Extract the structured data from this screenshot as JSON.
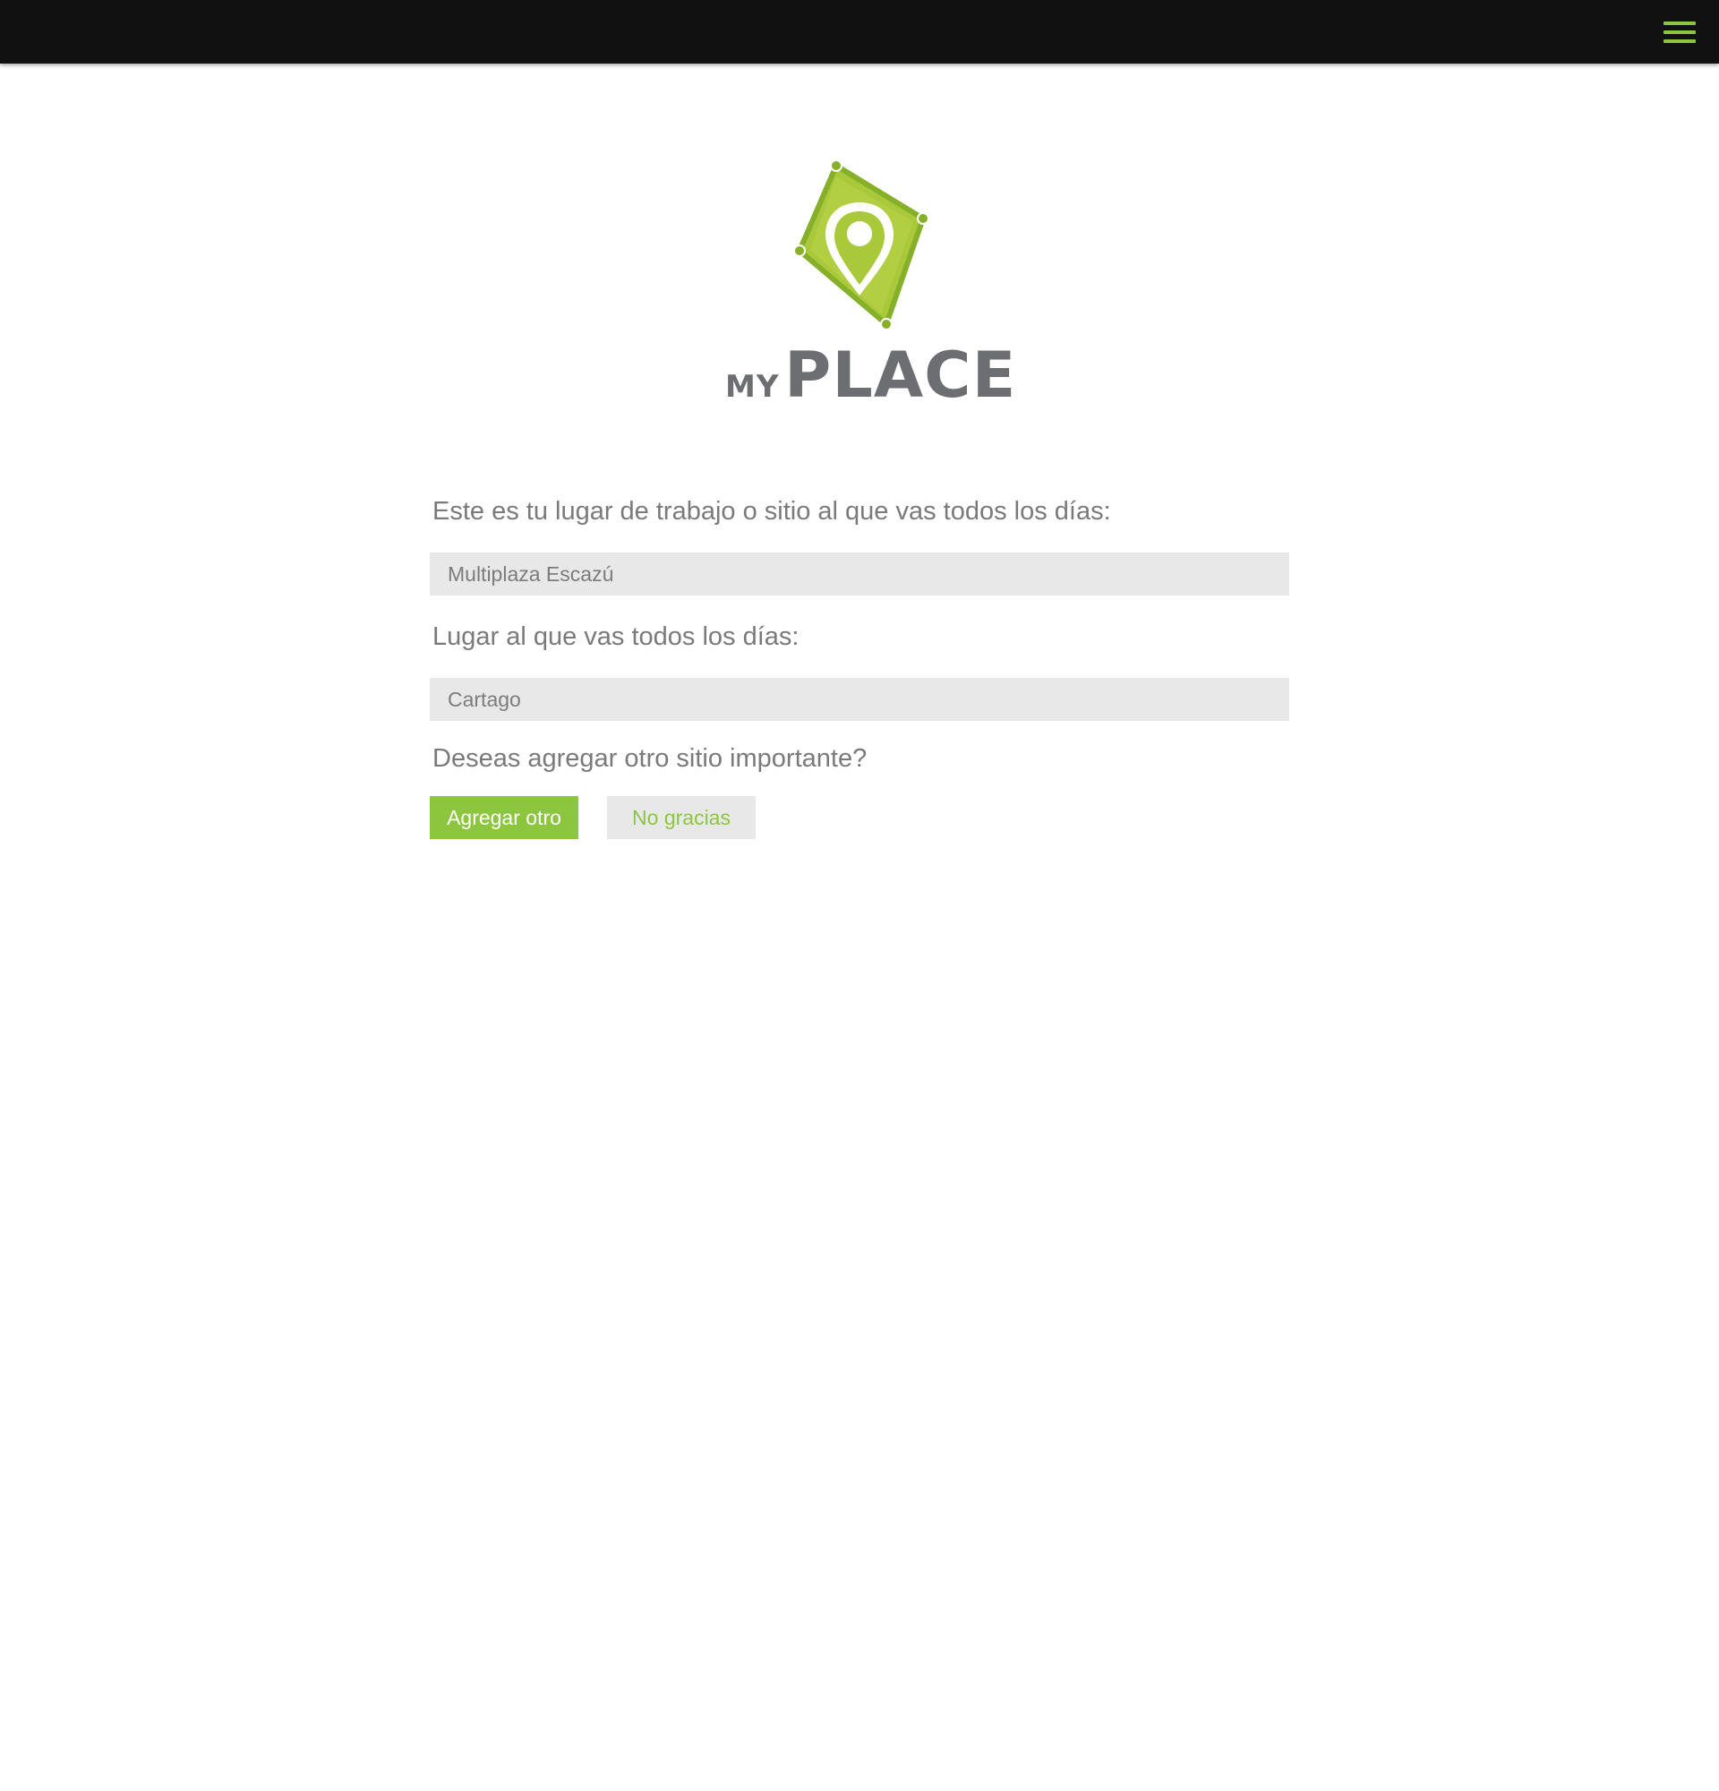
{
  "header": {
    "menu_icon": "hamburger-menu-icon",
    "accent_color": "#8cc63f",
    "background_color": "#111111"
  },
  "logo": {
    "icon": "map-pin-diamond-icon",
    "word_my": "MY",
    "word_place": "PLACE"
  },
  "form": {
    "question_1": "Este es tu lugar de trabajo o sitio al que vas todos los días:",
    "field_1_value": "Multiplaza Escazú",
    "question_2": "Lugar al que vas todos los días:",
    "field_2_value": "Cartago",
    "question_3": "Deseas agregar otro sitio importante?",
    "add_button": "Agregar otro",
    "decline_button": "No gracias"
  },
  "colors": {
    "accent": "#8cc63f",
    "logo_green": "#a5c63a",
    "text_gray": "#7a7a7a",
    "field_bg": "#e8e8e8"
  }
}
